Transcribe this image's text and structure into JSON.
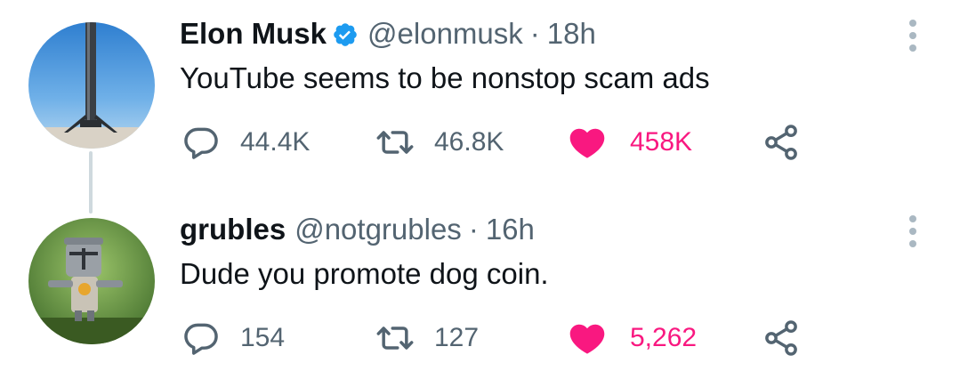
{
  "tweets": [
    {
      "name": "Elon Musk",
      "verified": true,
      "handle": "@elonmusk",
      "separator": "·",
      "time": "18h",
      "text": "YouTube seems to be nonstop scam ads",
      "replies": "44.4K",
      "retweets": "46.8K",
      "likes": "458K",
      "liked": true
    },
    {
      "name": "grubles",
      "verified": false,
      "handle": "@notgrubles",
      "separator": "·",
      "time": "16h",
      "text": "Dude you promote dog coin.",
      "replies": "154",
      "retweets": "127",
      "likes": "5,262",
      "liked": true
    }
  ],
  "icons": {
    "reply": "reply-icon",
    "retweet": "retweet-icon",
    "like": "heart-icon",
    "share": "share-icon",
    "more": "more-options-icon",
    "verified": "verified-badge-icon"
  },
  "colors": {
    "like": "#f91880",
    "verified": "#1d9bf0",
    "secondary": "#536471"
  }
}
